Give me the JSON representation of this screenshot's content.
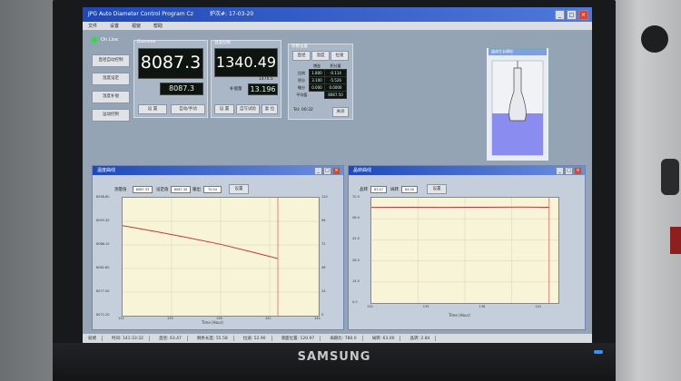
{
  "app": {
    "title": "JPG Auto Diameter Control Program  Cz",
    "furnace_label": "炉次#: 17-03-20"
  },
  "menu": [
    "文件",
    "设置",
    "视窗",
    "帮助"
  ],
  "left_panel": {
    "status": "On Line",
    "buttons": [
      "直径自动控制",
      "温度设定",
      "温度补偿",
      "运动控制"
    ]
  },
  "diameter": {
    "title": "Diameter",
    "value": "8087.3",
    "setpoint": "8087.3",
    "buttons": [
      "设 置",
      "自动/手动"
    ]
  },
  "temperature": {
    "title": "温度控制",
    "value": "1340.49",
    "sub_value": "1470.5",
    "comp_label": "补偿量",
    "comp_value": "13.196",
    "buttons": [
      "设 置",
      "自写试验",
      "复 位"
    ]
  },
  "params": {
    "title": "参数设置",
    "tabs": [
      "直径",
      "温度",
      "拉速"
    ],
    "header": [
      "",
      "增益",
      "积分量"
    ],
    "rows": [
      {
        "name": "比例",
        "a": "1.800",
        "b": "-0.114"
      },
      {
        "name": "积分",
        "a": "3.100",
        "b": "-5.526"
      },
      {
        "name": "微分",
        "a": "0.000",
        "b": "0.0000"
      },
      {
        "name": "平均值",
        "a": "",
        "b": "8087.50"
      }
    ],
    "footer": "Tel: 00:32",
    "close_label": "关闭"
  },
  "diagram": {
    "title": "晶体生长模拟"
  },
  "temp_chart": {
    "window_title": "温度曲线",
    "legend": [
      {
        "label": "测量值",
        "value": "8087.33"
      },
      {
        "label": "设定值",
        "value": "8087.30"
      },
      {
        "label": "输出",
        "value": "70.54"
      }
    ],
    "button": "设置",
    "xlabel": "Time (Hour)",
    "x_ticks": [
      "132",
      "135",
      "138",
      "141",
      "144"
    ],
    "y_ticks_left": [
      "8098.80",
      "8093.30",
      "8088.10",
      "8082.80",
      "8077.50",
      "8072.20"
    ],
    "y_ticks_right": [
      "120",
      "96",
      "72",
      "48",
      "24",
      "0"
    ],
    "line_color": "#c23a3a"
  },
  "speed_chart": {
    "window_title": "晶转曲线",
    "legend": [
      {
        "label": "晶转",
        "value": "63.47"
      },
      {
        "label": "埚转",
        "value": "64.00"
      }
    ],
    "button": "设置",
    "xlabel": "Time (Hour)",
    "x_ticks": [
      "132",
      "135",
      "138",
      "141"
    ],
    "y_ticks": [
      "70.0",
      "56.0",
      "42.0",
      "28.0",
      "14.0",
      "0.0"
    ],
    "line_color": "#c23a3a"
  },
  "chart_data": [
    {
      "type": "line",
      "title": "温度曲线",
      "xlabel": "Time (Hour)",
      "ylabel": "",
      "xlim": [
        132,
        144
      ],
      "ylim": [
        8072.2,
        8098.8
      ],
      "series": [
        {
          "name": "测量值",
          "x": [
            132,
            134,
            136,
            138,
            140,
            141.5
          ],
          "y": [
            8092.5,
            8091.2,
            8089.8,
            8088.3,
            8086.5,
            8085.1
          ]
        }
      ]
    },
    {
      "type": "line",
      "title": "晶转曲线",
      "xlabel": "Time (Hour)",
      "ylabel": "",
      "xlim": [
        132,
        142
      ],
      "ylim": [
        0,
        70
      ],
      "series": [
        {
          "name": "晶转",
          "x": [
            132,
            134,
            136,
            138,
            140,
            141.5
          ],
          "y": [
            63.6,
            63.7,
            63.6,
            63.7,
            63.8,
            63.7
          ]
        }
      ]
    }
  ],
  "statusbar": [
    "就绪",
    "时间: 141:33:32",
    "直径: 63.47",
    "剩余长度: 55.58",
    "拉速: 52.90",
    "液面位置: 120.97",
    "埚跟比: 780.0",
    "埚转: 63.00",
    "晶转: 2.84"
  ],
  "monitor": {
    "brand": "SAMSUNG"
  }
}
